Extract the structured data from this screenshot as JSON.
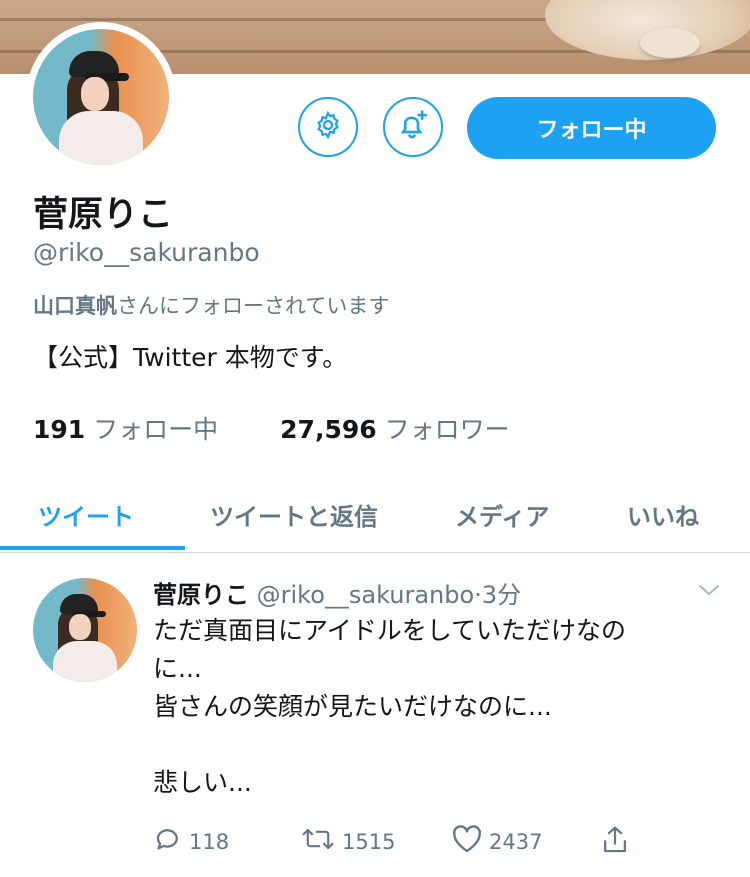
{
  "profile": {
    "name": "菅原りこ",
    "handle": "@riko__sakuranbo",
    "followed_by_name": "山口真帆",
    "followed_by_suffix": "さんにフォローされています",
    "bio": "【公式】Twitter 本物です。",
    "following_count": "191",
    "following_label": "フォロー中",
    "followers_count": "27,596",
    "followers_label": "フォロワー",
    "follow_button": "フォロー中"
  },
  "icons": {
    "settings": "gear-icon",
    "notify": "bell-plus-icon",
    "reply": "reply-icon",
    "retweet": "retweet-icon",
    "like": "heart-icon",
    "share": "share-icon",
    "caret": "chevron-down-icon"
  },
  "tabs": [
    {
      "label": "ツイート",
      "active": true
    },
    {
      "label": "ツイートと返信",
      "active": false
    },
    {
      "label": "メディア",
      "active": false
    },
    {
      "label": "いいね",
      "active": false
    }
  ],
  "tweet": {
    "name": "菅原りこ",
    "handle": "@riko__sakuranbo",
    "separator": "·",
    "time": "3分",
    "lines": [
      "ただ真面目にアイドルをしていただけなの",
      "に...",
      "皆さんの笑顔が見たいだけなのに...",
      "",
      "悲しい..."
    ],
    "replies": "118",
    "retweets": "1515",
    "likes": "2437"
  },
  "colors": {
    "accent": "#1da1f2",
    "secondary_text": "#657786",
    "primary_text": "#14171a"
  }
}
